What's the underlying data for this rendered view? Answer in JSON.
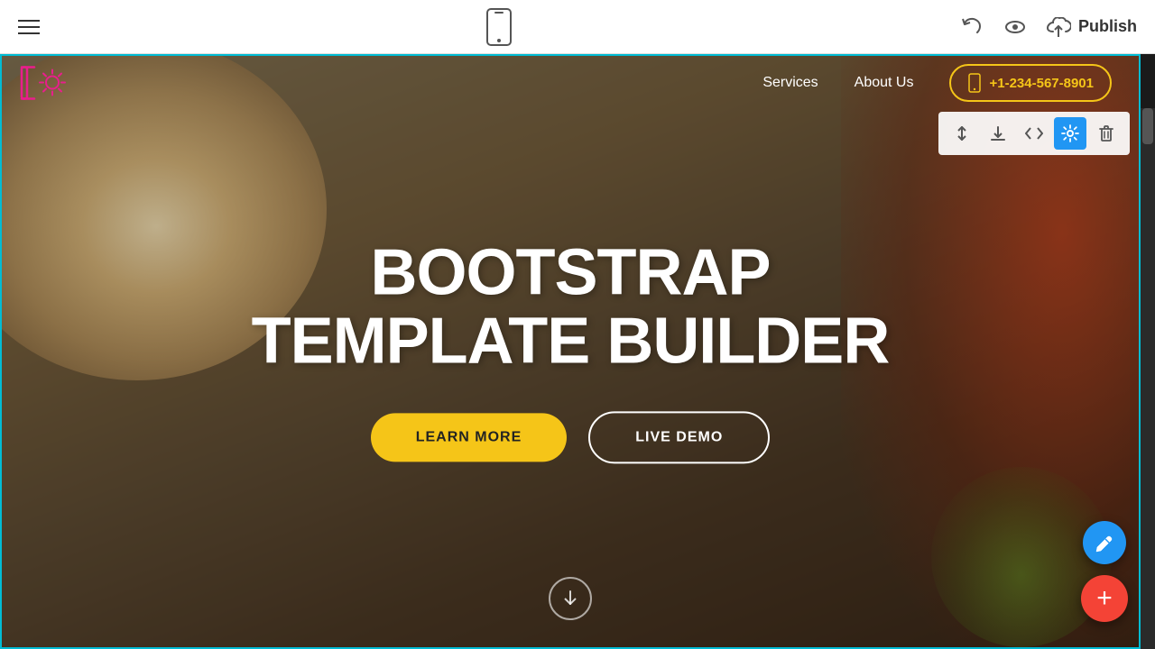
{
  "toolbar": {
    "publish_label": "Publish",
    "hamburger_label": "Menu"
  },
  "site": {
    "nav": {
      "services": "Services",
      "about_us": "About Us",
      "phone": "+1-234-567-8901"
    },
    "hero": {
      "title_line1": "BOOTSTRAP",
      "title_line2": "TEMPLATE BUILDER",
      "btn_learn_more": "LEARN MORE",
      "btn_live_demo": "LIVE DEMO"
    }
  },
  "section_tools": {
    "move": "↕",
    "download": "⬇",
    "code": "</>",
    "settings": "⚙",
    "delete": "🗑"
  },
  "fab": {
    "edit": "✏",
    "add": "+"
  },
  "scroll_arrow": "↓"
}
